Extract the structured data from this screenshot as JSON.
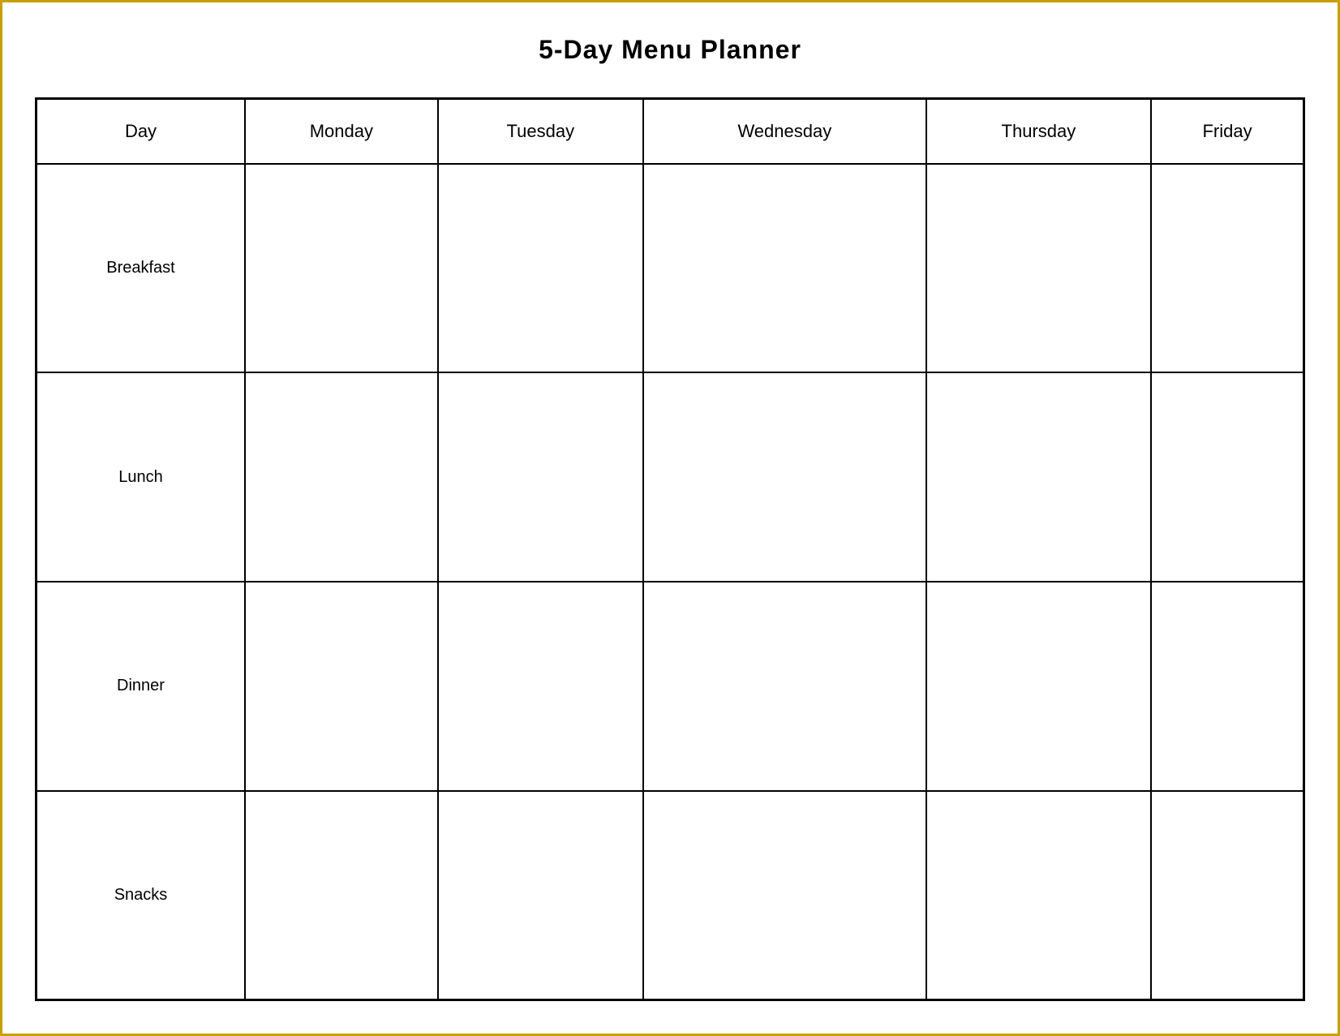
{
  "title": "5-Day Menu Planner",
  "headers": {
    "col0": "Day",
    "col1": "Monday",
    "col2": "Tuesday",
    "col3": "Wednesday",
    "col4": "Thursday",
    "col5": "Friday"
  },
  "rows": [
    {
      "label": "Breakfast"
    },
    {
      "label": "Lunch"
    },
    {
      "label": "Dinner"
    },
    {
      "label": "Snacks"
    }
  ]
}
